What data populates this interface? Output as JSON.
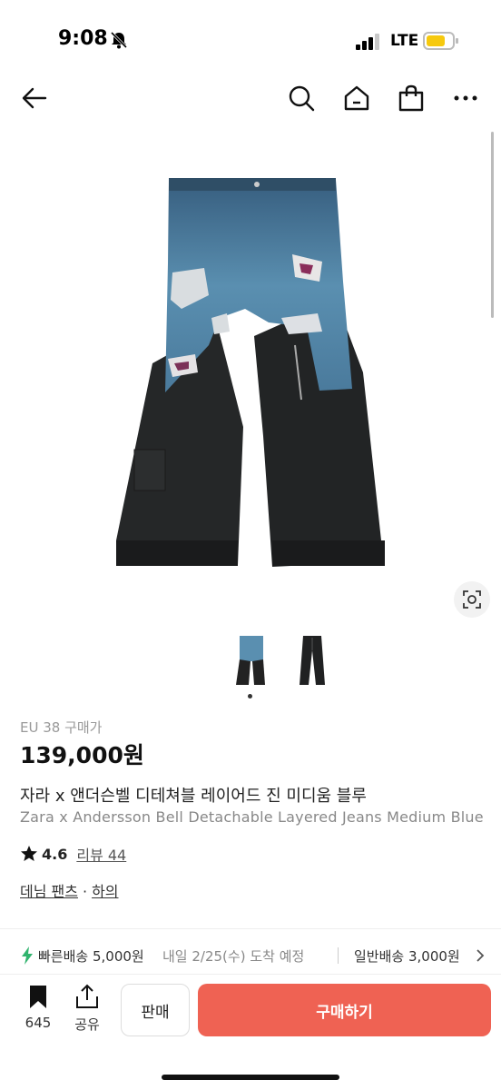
{
  "status_bar": {
    "time": "9:08",
    "network": "LTE"
  },
  "nav": {
    "back_icon": "arrow-left-icon",
    "search_icon": "search-icon",
    "home_icon": "home-icon",
    "bag_icon": "shopping-bag-icon",
    "more_icon": "more-horizontal-icon"
  },
  "product": {
    "size_label": "EU 38 구매가",
    "price": "139,000원",
    "title_ko": "자라 x 앤더슨벨 디테쳐블 레이어드 진 미디움 블루",
    "title_en": "Zara x Andersson Bell Detachable Layered Jeans Medium Blue",
    "rating": "4.6",
    "review_label": "리뷰 44",
    "category_main": "데님 팬츠",
    "category_sep": "·",
    "category_sub": "하의"
  },
  "delivery": {
    "fast_label": "빠른배송 5,000원",
    "fast_eta": "내일 2/25(수) 도착 예정",
    "normal_label": "일반배송 3,000원"
  },
  "bottom": {
    "bookmark_count": "645",
    "share_label": "공유",
    "sell_label": "판매",
    "buy_label": "구매하기"
  },
  "colors": {
    "accent": "#ef6253",
    "fast_icon": "#31b46e"
  }
}
